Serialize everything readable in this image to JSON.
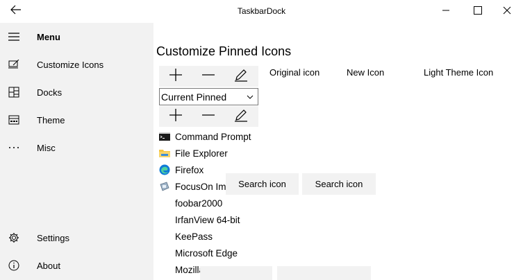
{
  "app": {
    "title": "TaskbarDock"
  },
  "sidebar": {
    "items": [
      {
        "label": "Menu",
        "icon": "hamburger-icon"
      },
      {
        "label": "Customize Icons",
        "icon": "customize-icon"
      },
      {
        "label": "Docks",
        "icon": "docks-icon"
      },
      {
        "label": "Theme",
        "icon": "theme-icon"
      },
      {
        "label": "Misc",
        "icon": "more-icon"
      },
      {
        "label": "Settings",
        "icon": "gear-icon"
      },
      {
        "label": "About",
        "icon": "info-icon"
      }
    ]
  },
  "main": {
    "title": "Customize Pinned Icons",
    "combo": {
      "value": "Current Pinned"
    },
    "columns": {
      "original": "Original icon",
      "new": "New Icon",
      "light": "Light Theme Icon"
    },
    "search_buttons": [
      "Search icon",
      "Search icon"
    ],
    "items": [
      {
        "label": "Command Prompt",
        "icon": "cmd-icon"
      },
      {
        "label": "File Explorer",
        "icon": "folder-icon"
      },
      {
        "label": "Firefox",
        "icon": "edge-icon"
      },
      {
        "label": "FocusOn Im",
        "icon": "focuson-icon"
      },
      {
        "label": "foobar2000",
        "icon": ""
      },
      {
        "label": "IrfanView 64-bit",
        "icon": ""
      },
      {
        "label": "KeePass",
        "icon": ""
      },
      {
        "label": "Microsoft Edge",
        "icon": ""
      },
      {
        "label": "Mozilla Thunderbird",
        "icon": ""
      }
    ]
  },
  "colors": {
    "sidebar_bg": "#f2f2f2",
    "toolbar_bg": "#f2f2f2",
    "edge_blue": "#0f7bd8",
    "folder_yellow": "#f4c542"
  }
}
